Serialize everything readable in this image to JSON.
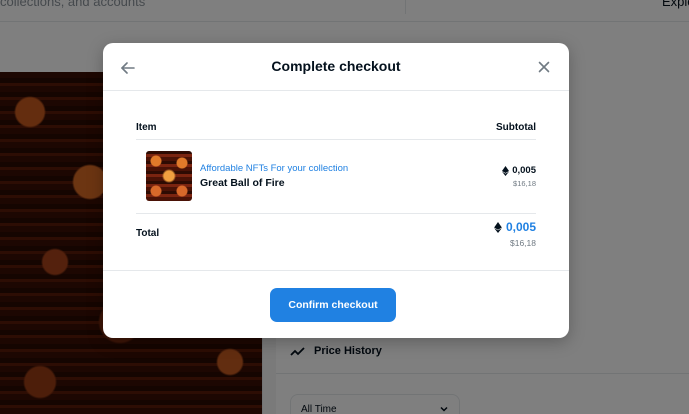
{
  "background": {
    "search_placeholder": "collections, and accounts",
    "nav_partial": "Explo",
    "price_history_label": "Price History",
    "time_filter": "All Time"
  },
  "modal": {
    "title": "Complete checkout",
    "table": {
      "columns": [
        "Item",
        "Subtotal"
      ],
      "rows": [
        {
          "collection": "Affordable NFTs For your collection",
          "name": "Great Ball of Fire",
          "price_eth": "0,005",
          "price_usd": "$16,18"
        }
      ]
    },
    "total": {
      "label": "Total",
      "price_eth": "0,005",
      "price_usd": "$16,18"
    },
    "confirm_label": "Confirm checkout"
  },
  "icons": {
    "back": "arrow-left-icon",
    "close": "close-icon",
    "currency": "ethereum-icon",
    "refresh": "refresh-icon",
    "price_history": "trend-line-icon",
    "dropdown": "chevron-down-icon"
  },
  "colors": {
    "accent": "#2081e2",
    "text_primary": "#04111d",
    "text_secondary": "#707a83",
    "divider": "#e5e8eb",
    "overlay": "rgba(0,0,0,0.5)"
  }
}
